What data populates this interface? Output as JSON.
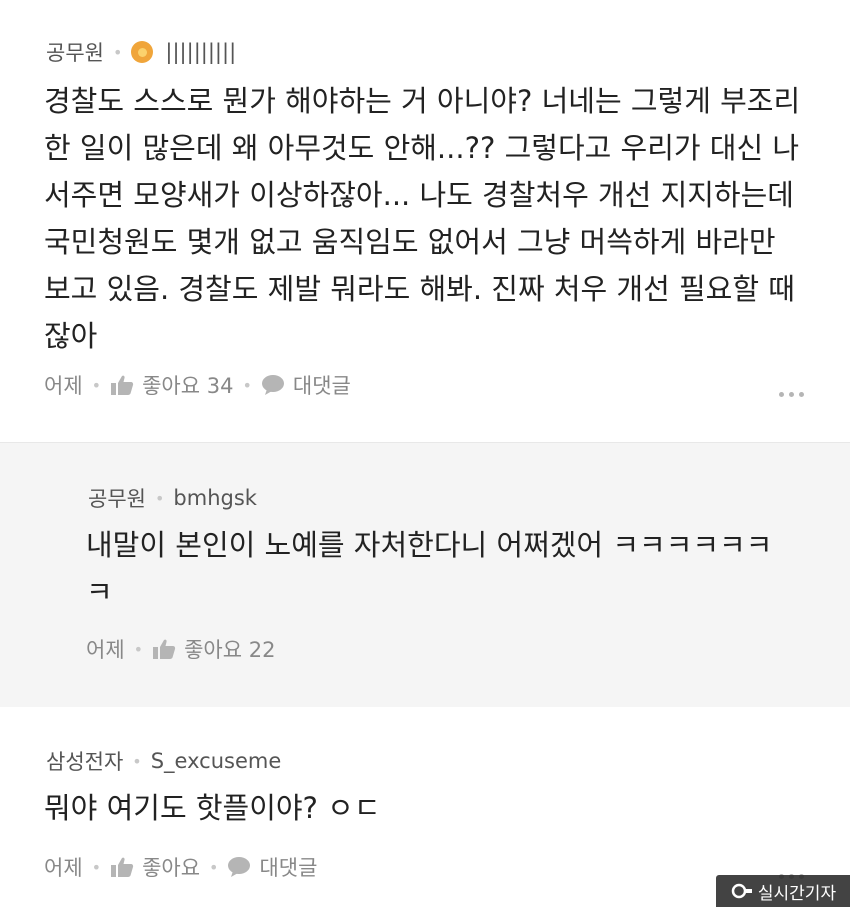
{
  "comments": [
    {
      "org": "공무원",
      "nickname": "||||||||||",
      "body_lines": [
        "경찰도 스스로 뭔가 해야하는 거 아니야? 너네는 그렇게 부조리",
        "한 일이 많은데 왜 아무것도 안해...?? 그렇다고 우리가 대신 나",
        "서주면 모양새가 이상하잖아... 나도 경찰처우 개선 지지하는데",
        "국민청원도 몇개 없고 움직임도 없어서 그냥 머쓱하게 바라만",
        "보고 있음. 경찰도 제발 뭐라도 해봐. 진짜 처우 개선 필요할 때",
        "잖아"
      ],
      "time": "어제",
      "like_text": "좋아요 34",
      "reply_label": "대댓글"
    },
    {
      "org": "공무원",
      "nickname": "bmhgsk",
      "body_lines": [
        "내말이 본인이 노예를 자처한다니 어쩌겠어 ㅋㅋㅋㅋㅋㅋ",
        "ㅋ"
      ],
      "time": "어제",
      "like_text": "좋아요 22"
    },
    {
      "org": "삼성전자",
      "nickname": "S_excuseme",
      "body_lines": [
        "뭐야 여기도 핫플이야? ㅇㄷ"
      ],
      "time": "어제",
      "like_text": "좋아요",
      "reply_label": "대댓글"
    }
  ],
  "watermark": {
    "text": "실시간기자"
  },
  "icons": {
    "badge": "sun-badge-icon",
    "like": "thumbs-up-icon",
    "reply": "speech-bubble-icon",
    "more": "more-dots-icon"
  },
  "colors": {
    "badge": "#f0a53a",
    "reply_bg": "#f5f5f5",
    "meta_text": "#888888"
  }
}
